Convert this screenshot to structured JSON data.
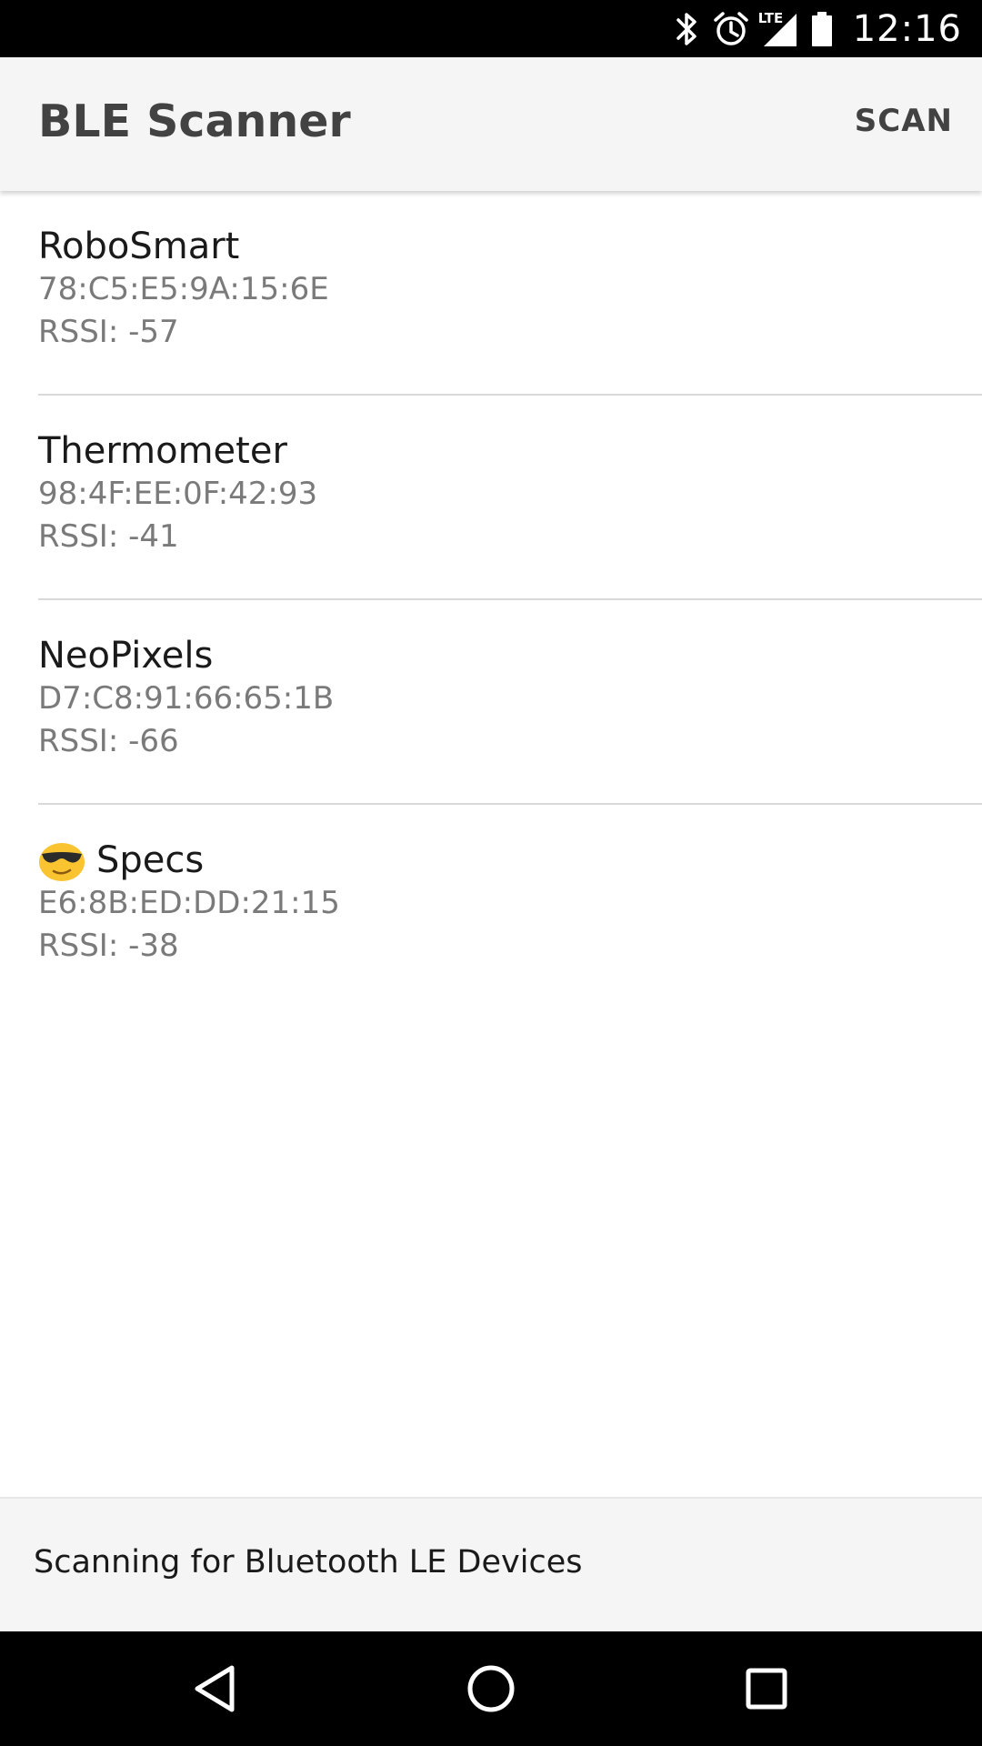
{
  "status_bar": {
    "time": "12:16",
    "network": "LTE",
    "icons": [
      "bluetooth-icon",
      "alarm-icon",
      "lte-signal-icon",
      "battery-icon"
    ]
  },
  "app_bar": {
    "title": "BLE Scanner",
    "scan_label": "SCAN"
  },
  "devices": [
    {
      "name": "RoboSmart",
      "address": "78:C5:E5:9A:15:6E",
      "rssi": "RSSI: -57"
    },
    {
      "name": "Thermometer",
      "address": "98:4F:EE:0F:42:93",
      "rssi": "RSSI: -41"
    },
    {
      "name": "NeoPixels",
      "address": "D7:C8:91:66:65:1B",
      "rssi": "RSSI: -66"
    },
    {
      "name": "Specs",
      "icon": "sunglasses-emoji-icon",
      "address": "E6:8B:ED:DD:21:15",
      "rssi": "RSSI: -38"
    }
  ],
  "scan_status": {
    "text": "Scanning for Bluetooth LE Devices"
  },
  "nav_bar": {
    "buttons": [
      "back-icon",
      "home-icon",
      "recents-icon"
    ]
  },
  "colors": {
    "app_bar_bg": "#f5f5f5",
    "title_text": "#424242",
    "secondary_text": "#7a7a7a",
    "divider": "#d9d9d9",
    "emoji_face": "#f9c430"
  }
}
